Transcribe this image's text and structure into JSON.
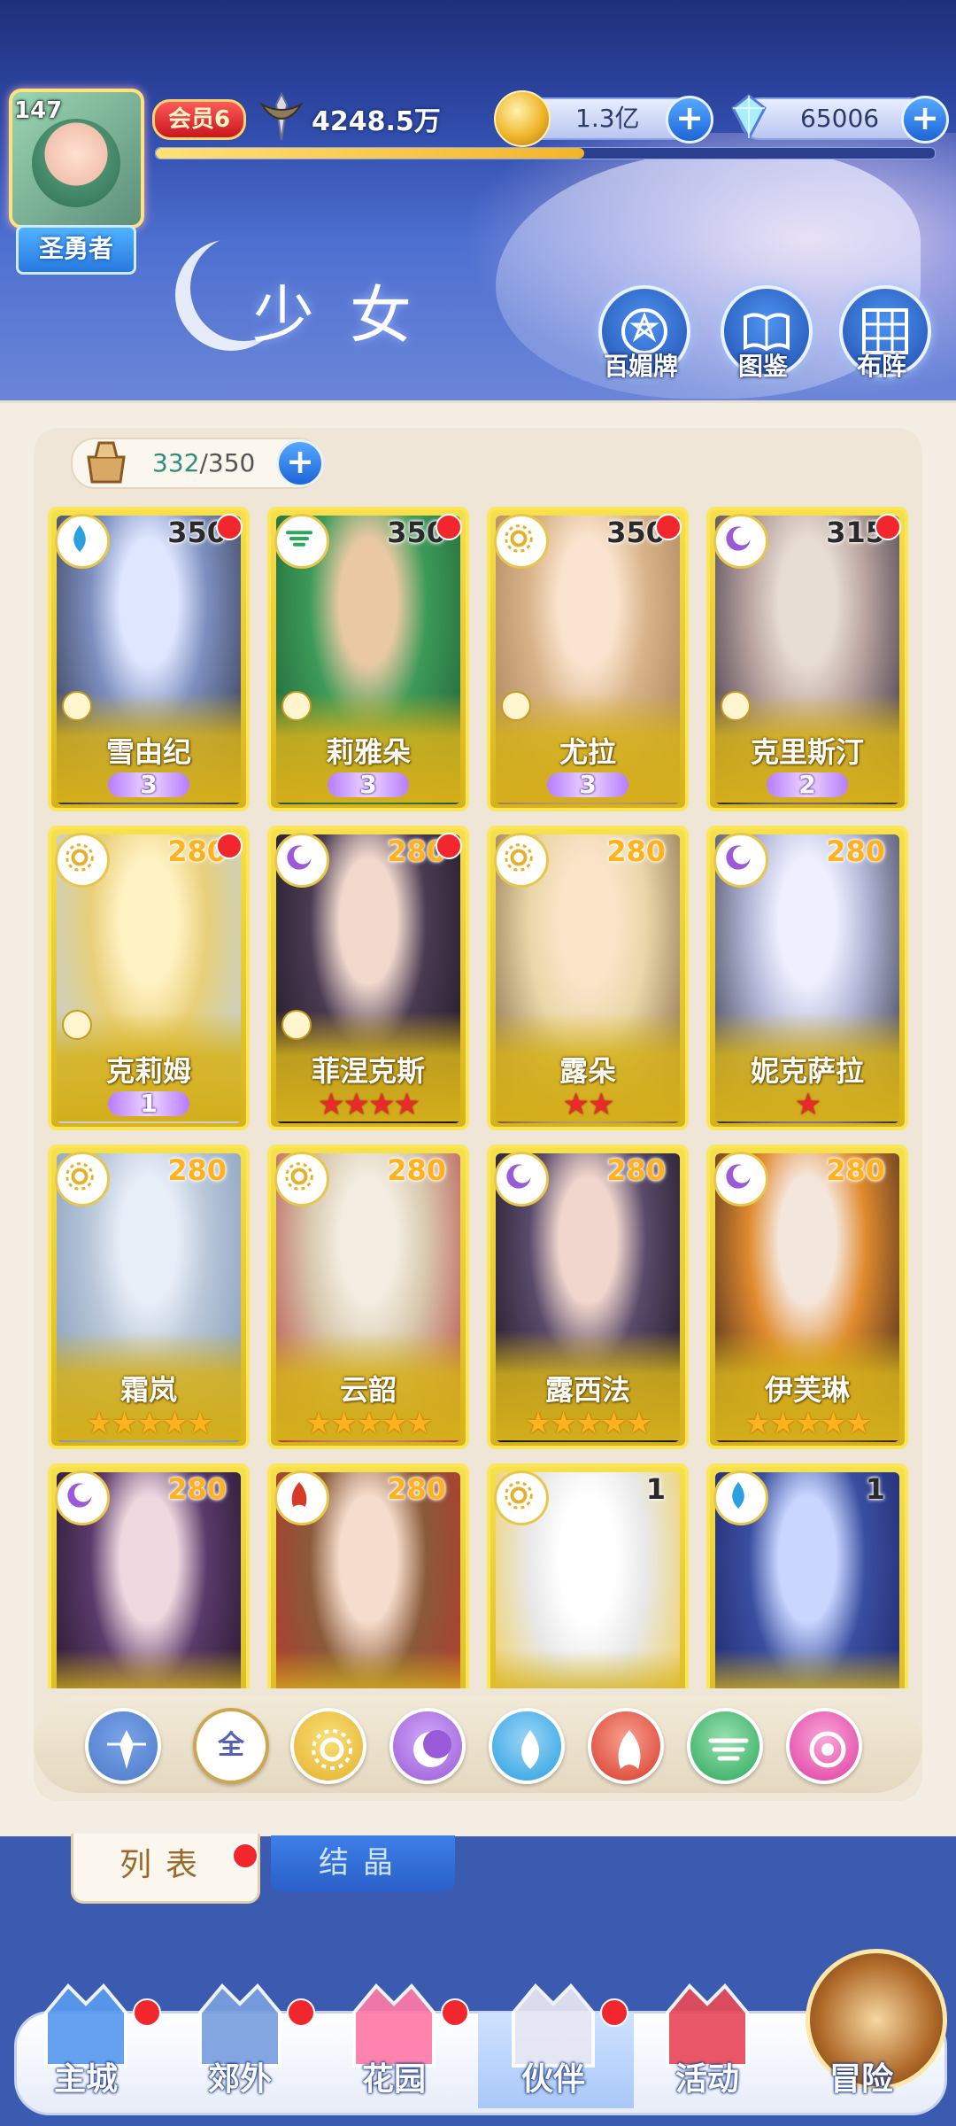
{
  "header": {
    "title": "少女",
    "player": {
      "level": "147",
      "title_badge": "圣勇者",
      "vip": "会员6",
      "power": "4248.5万"
    },
    "resources": {
      "gold": "1.3亿",
      "gems": "65006"
    },
    "progress_fraction": 0.55,
    "buttons": [
      {
        "label": "百媚牌",
        "icon": "card-deck-icon"
      },
      {
        "label": "图鉴",
        "icon": "book-icon"
      },
      {
        "label": "布阵",
        "icon": "grid-formation-icon"
      }
    ]
  },
  "collection": {
    "current": "332",
    "max": "350",
    "separator": "/"
  },
  "cards": [
    {
      "name": "雪由纪",
      "level": "350",
      "element": "water",
      "awaken": "3",
      "stars": 0,
      "star_color": "",
      "badge": true,
      "red_dot": true,
      "palette": [
        "#dfe6ff",
        "#7d8fbf",
        "#2b2f3e"
      ]
    },
    {
      "name": "莉雅朵",
      "level": "350",
      "element": "wind",
      "awaken": "3",
      "stars": 0,
      "star_color": "",
      "badge": true,
      "red_dot": true,
      "palette": [
        "#e9c9a4",
        "#3d9a58",
        "#1e5a34"
      ]
    },
    {
      "name": "尤拉",
      "level": "350",
      "element": "light",
      "awaken": "3",
      "stars": 0,
      "star_color": "",
      "badge": true,
      "red_dot": true,
      "palette": [
        "#fbe4cf",
        "#d9b48a",
        "#a07a52"
      ]
    },
    {
      "name": "克里斯汀",
      "level": "315",
      "element": "dark",
      "awaken": "2",
      "stars": 0,
      "star_color": "",
      "badge": true,
      "red_dot": true,
      "palette": [
        "#e7dcd3",
        "#b9a4a0",
        "#2a2436"
      ]
    },
    {
      "name": "克莉姆",
      "level": "280",
      "element": "light",
      "awaken": "1",
      "stars": 0,
      "star_color": "",
      "badge": true,
      "red_dot": true,
      "palette": [
        "#fff2c2",
        "#e8cf7a",
        "#b8d2f0"
      ]
    },
    {
      "name": "菲涅克斯",
      "level": "280",
      "element": "dark",
      "awaken": "",
      "stars": 4,
      "star_color": "red",
      "badge": true,
      "red_dot": true,
      "palette": [
        "#f0d8cc",
        "#4a3a52",
        "#1a1420"
      ]
    },
    {
      "name": "露朵",
      "level": "280",
      "element": "light",
      "awaken": "",
      "stars": 2,
      "star_color": "red",
      "badge": false,
      "red_dot": false,
      "palette": [
        "#fbe3c8",
        "#e9d7a8",
        "#7a5a3a"
      ]
    },
    {
      "name": "妮克萨拉",
      "level": "280",
      "element": "dark",
      "awaken": "",
      "stars": 1,
      "star_color": "red",
      "badge": false,
      "red_dot": false,
      "palette": [
        "#eef0ff",
        "#b5b9d8",
        "#2a2a3a"
      ]
    },
    {
      "name": "霜岚",
      "level": "280",
      "element": "light",
      "awaken": "",
      "stars": 5,
      "star_color": "gold",
      "badge": false,
      "red_dot": false,
      "palette": [
        "#e8eef8",
        "#b9c7d9",
        "#7a95b4"
      ]
    },
    {
      "name": "云韶",
      "level": "280",
      "element": "light",
      "awaken": "",
      "stars": 5,
      "star_color": "gold",
      "badge": false,
      "red_dot": false,
      "palette": [
        "#f3ece0",
        "#d8c9ae",
        "#b33a3a"
      ]
    },
    {
      "name": "露西法",
      "level": "280",
      "element": "dark",
      "awaken": "",
      "stars": 5,
      "star_color": "gold",
      "badge": false,
      "red_dot": false,
      "palette": [
        "#f0d6cc",
        "#5a4a6a",
        "#141018"
      ]
    },
    {
      "name": "伊芙琳",
      "level": "280",
      "element": "dark",
      "awaken": "",
      "stars": 5,
      "star_color": "gold",
      "badge": false,
      "red_dot": false,
      "palette": [
        "#f5e6dc",
        "#e08a2e",
        "#2a1a1a"
      ]
    },
    {
      "name": "",
      "level": "280",
      "element": "dark",
      "awaken": "",
      "stars": 0,
      "star_color": "",
      "badge": false,
      "red_dot": false,
      "palette": [
        "#f0d8e0",
        "#5a3a6a",
        "#1a1020"
      ]
    },
    {
      "name": "",
      "level": "280",
      "element": "fire",
      "awaken": "",
      "stars": 0,
      "star_color": "",
      "badge": false,
      "red_dot": false,
      "palette": [
        "#f6dccc",
        "#8a5a3a",
        "#c0302a"
      ]
    },
    {
      "name": "",
      "level": "1",
      "element": "light",
      "awaken": "",
      "stars": 0,
      "star_color": "",
      "badge": false,
      "red_dot": false,
      "palette": [
        "#ffffff",
        "#e8e8e8",
        "#f3c83a"
      ]
    },
    {
      "name": "",
      "level": "1",
      "element": "water",
      "awaken": "",
      "stars": 0,
      "star_color": "",
      "badge": false,
      "red_dot": false,
      "palette": [
        "#c9d6ff",
        "#3a4ea0",
        "#1a2060"
      ]
    }
  ],
  "filters": [
    {
      "id": "all-types",
      "label": "",
      "color": "#4d7ac8",
      "ring": "#7aa3e8",
      "icon": "triple-star-icon"
    },
    {
      "id": "all",
      "label": "全",
      "color": "#ffffff",
      "ring": "#cfa650",
      "icon": "all-filter"
    },
    {
      "id": "light",
      "label": "",
      "color": "#e5b02a",
      "ring": "#f8e07a",
      "icon": "sun-icon"
    },
    {
      "id": "dark",
      "label": "",
      "color": "#9a5ad8",
      "ring": "#d0a8f8",
      "icon": "moon-icon"
    },
    {
      "id": "water",
      "label": "",
      "color": "#2aa0e0",
      "ring": "#9ad4f8",
      "icon": "water-drop-icon"
    },
    {
      "id": "fire",
      "label": "",
      "color": "#d83a2a",
      "ring": "#f8a090",
      "icon": "flame-icon"
    },
    {
      "id": "wind",
      "label": "",
      "color": "#2aa85a",
      "ring": "#9ae0b0",
      "icon": "whirlwind-icon"
    },
    {
      "id": "special",
      "label": "",
      "color": "#e03aa0",
      "ring": "#f8a8d8",
      "icon": "orb-icon"
    }
  ],
  "tabs": {
    "list": "列表",
    "crystal": "结晶"
  },
  "nav": [
    {
      "label": "主城",
      "icon": "castle-icon",
      "red_dot": true
    },
    {
      "label": "郊外",
      "icon": "portal-icon",
      "red_dot": true
    },
    {
      "label": "花园",
      "icon": "heart-garden-icon",
      "red_dot": true
    },
    {
      "label": "伙伴",
      "icon": "partner-icon",
      "red_dot": true,
      "active": true
    },
    {
      "label": "活动",
      "icon": "gift-icon",
      "red_dot": false
    },
    {
      "label": "冒险",
      "icon": "compass-icon",
      "red_dot": false
    }
  ],
  "colors": {
    "level_white": "#2a2a2a",
    "level_gold": "#ffb21c",
    "elements": {
      "water": "#2aa0e0",
      "wind": "#2aa85a",
      "light": "#e5b02a",
      "dark": "#9a5ad8",
      "fire": "#d83a2a"
    }
  }
}
